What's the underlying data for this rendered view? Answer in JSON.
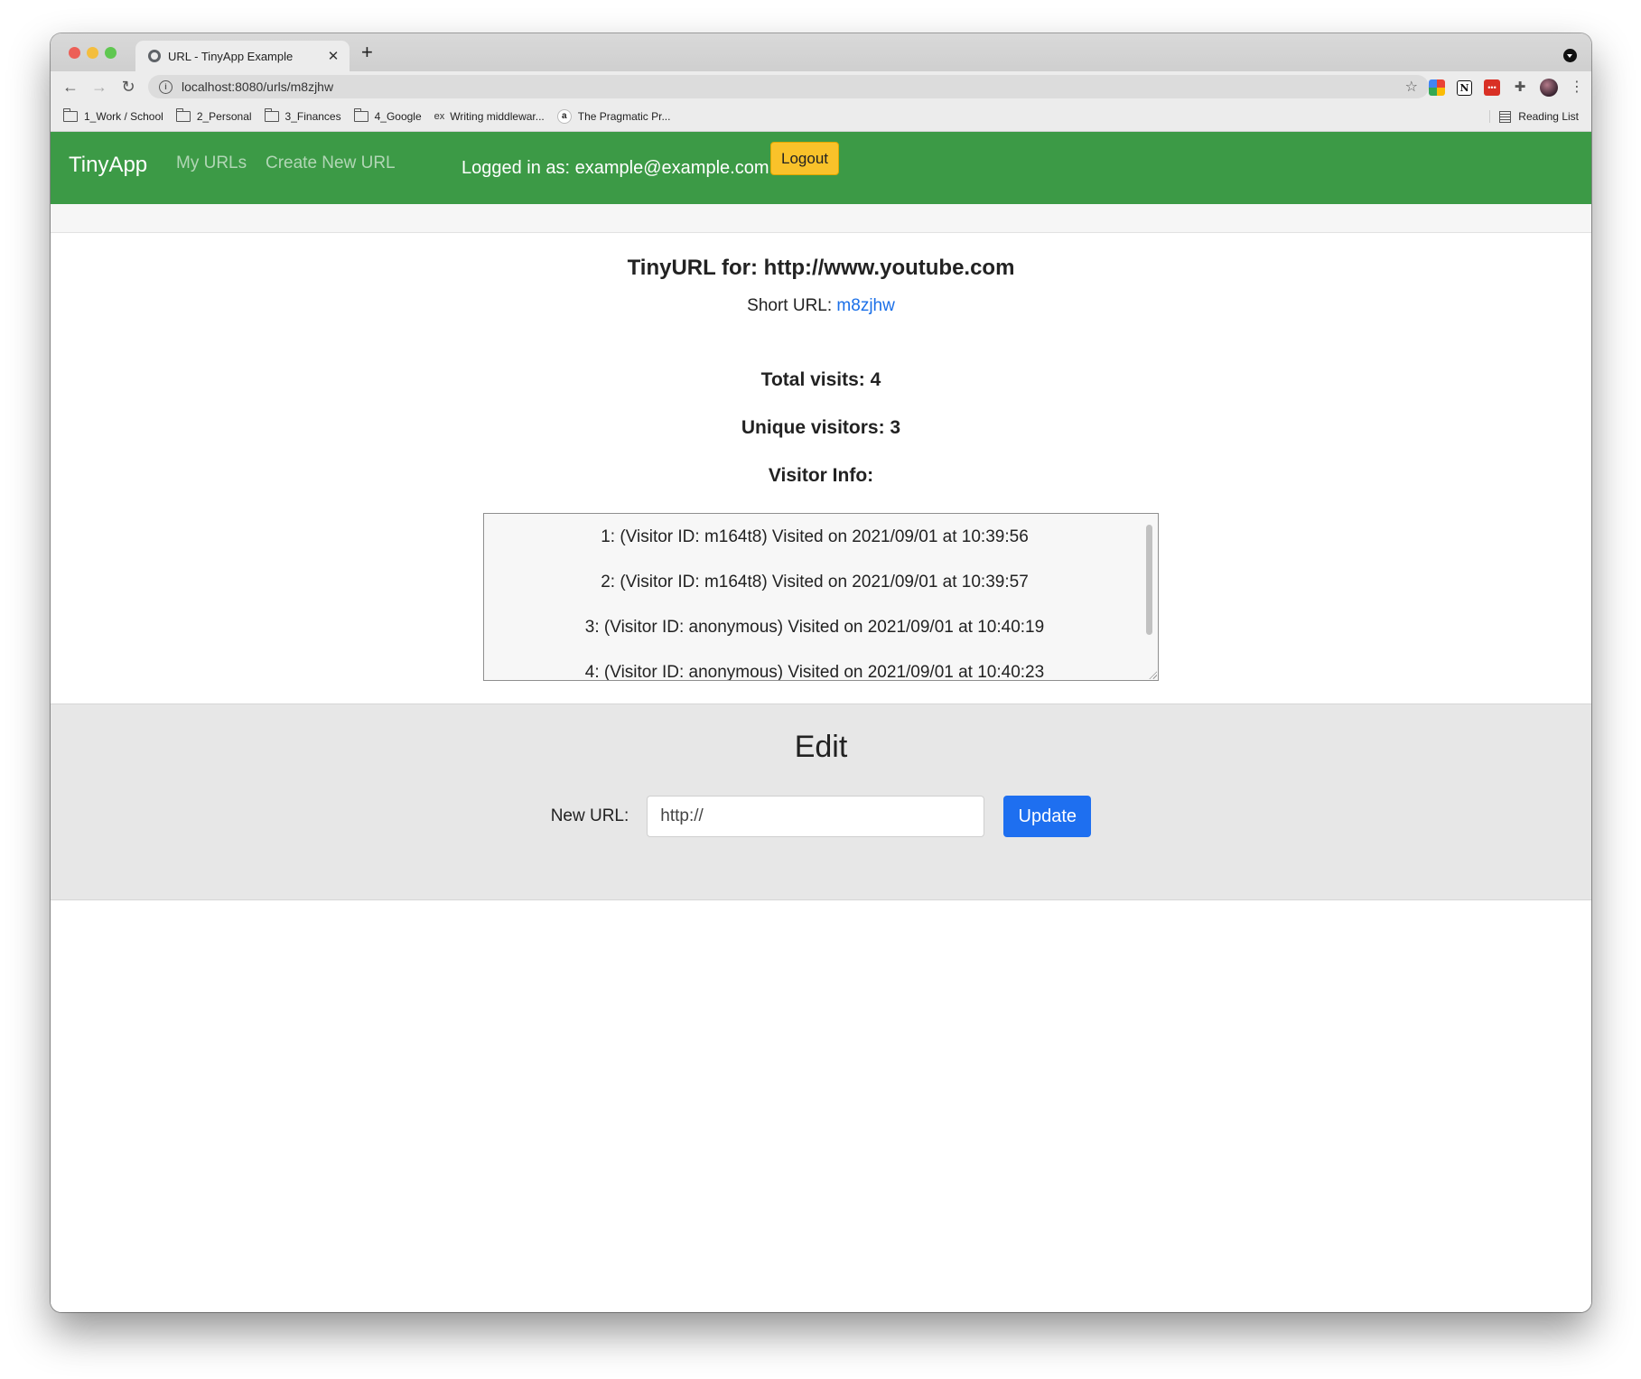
{
  "browser": {
    "tab_title": "URL - TinyApp Example",
    "tab_close": "✕",
    "new_tab": "+",
    "url": "localhost:8080/urls/m8zjhw",
    "bookmarks": [
      {
        "label": "1_Work / School"
      },
      {
        "label": "2_Personal"
      },
      {
        "label": "3_Finances"
      },
      {
        "label": "4_Google"
      },
      {
        "label": "Writing middlewar...",
        "badge": "ex"
      },
      {
        "label": "The Pragmatic Pr...",
        "badge": "a"
      }
    ],
    "reading_list": "Reading List",
    "icons": {
      "back": "back-arrow-icon",
      "forward": "forward-arrow-icon",
      "reload": "reload-icon",
      "info": "info-icon",
      "star": "star-icon",
      "extensions": "puzzle-icon",
      "menu": "kebab-menu-icon"
    }
  },
  "navbar": {
    "brand": "TinyApp",
    "links": [
      "My URLs",
      "Create New URL"
    ],
    "logged_in": "Logged in as: example@example.com",
    "logout": "Logout",
    "color": "#3c9a46"
  },
  "main": {
    "title": "TinyURL for: http://www.youtube.com",
    "short_label": "Short URL: ",
    "short_code": "m8zjhw",
    "total_visits": "Total visits: 4",
    "unique_visitors": "Unique visitors: 3",
    "visitor_info_heading": "Visitor Info:",
    "visitors": [
      "1: (Visitor ID: m164t8) Visited on 2021/09/01 at 10:39:56",
      "2: (Visitor ID: m164t8) Visited on 2021/09/01 at 10:39:57",
      "3: (Visitor ID: anonymous) Visited on 2021/09/01 at 10:40:19",
      "4: (Visitor ID: anonymous) Visited on 2021/09/01 at 10:40:23"
    ]
  },
  "edit": {
    "title": "Edit",
    "label": "New URL:",
    "placeholder": "http://",
    "button": "Update",
    "button_color": "#1e6ff0"
  }
}
